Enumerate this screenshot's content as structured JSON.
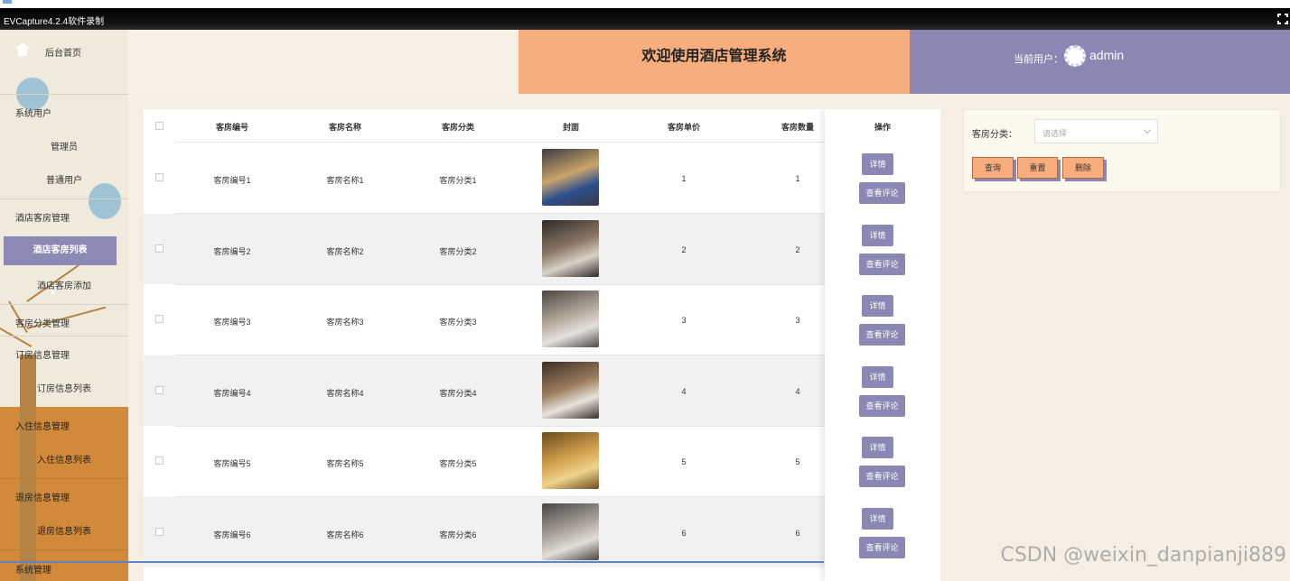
{
  "window": {
    "title": "EVCapture4.2.4软件录制"
  },
  "header": {
    "title": "欢迎使用酒店管理系统",
    "user_label": "当前用户：",
    "user_name": "admin"
  },
  "sidebar": {
    "home": "后台首页",
    "items": [
      {
        "label": "系统用户"
      },
      {
        "label": "管理员"
      },
      {
        "label": "普通用户"
      },
      {
        "label": "酒店客房管理"
      },
      {
        "label": "酒店客房列表"
      },
      {
        "label": "酒店客房添加"
      },
      {
        "label": "客房分类管理"
      },
      {
        "label": "订房信息管理"
      },
      {
        "label": "订房信息列表"
      },
      {
        "label": "入住信息管理"
      },
      {
        "label": "入住信息列表"
      },
      {
        "label": "退房信息管理"
      },
      {
        "label": "退房信息列表"
      },
      {
        "label": "系统管理"
      }
    ]
  },
  "table": {
    "columns": [
      "客房编号",
      "客房名称",
      "客房分类",
      "封面",
      "客房单价",
      "客房数量",
      "操作"
    ],
    "rows": [
      {
        "code": "客房编号1",
        "name": "客房名称1",
        "category": "客房分类1",
        "price": "1",
        "qty": "1"
      },
      {
        "code": "客房编号2",
        "name": "客房名称2",
        "category": "客房分类2",
        "price": "2",
        "qty": "2"
      },
      {
        "code": "客房编号3",
        "name": "客房名称3",
        "category": "客房分类3",
        "price": "3",
        "qty": "3"
      },
      {
        "code": "客房编号4",
        "name": "客房名称4",
        "category": "客房分类4",
        "price": "4",
        "qty": "4"
      },
      {
        "code": "客房编号5",
        "name": "客房名称5",
        "category": "客房分类5",
        "price": "5",
        "qty": "5"
      },
      {
        "code": "客房编号6",
        "name": "客房名称6",
        "category": "客房分类6",
        "price": "6",
        "qty": "6"
      }
    ],
    "detail_label": "详情",
    "review_label": "查看评论"
  },
  "search": {
    "category_label": "客房分类：",
    "category_placeholder": "请选择",
    "query_label": "查询",
    "reset_label": "重置",
    "delete_label": "删除"
  },
  "watermark": "CSDN @weixin_danpianji889",
  "colors": {
    "accent_orange": "#f8ad7c",
    "accent_purple": "#8a87b4",
    "sidebar_orange": "#d18a3a"
  }
}
